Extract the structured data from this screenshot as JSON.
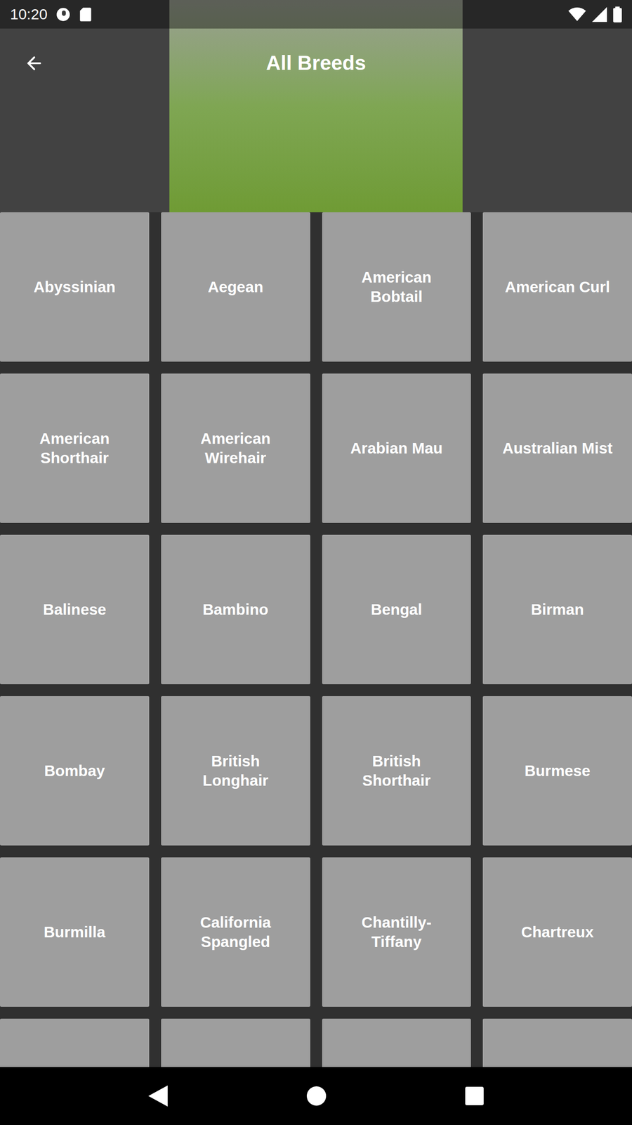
{
  "status_bar": {
    "time": "10:20"
  },
  "app_bar": {
    "title": "All Breeds"
  },
  "breeds": [
    "Abyssinian",
    "Aegean",
    "American Bobtail",
    "American Curl",
    "American Shorthair",
    "American Wirehair",
    "Arabian Mau",
    "Australian Mist",
    "Balinese",
    "Bambino",
    "Bengal",
    "Birman",
    "Bombay",
    "British Longhair",
    "British Shorthair",
    "Burmese",
    "Burmilla",
    "California Spangled",
    "Chantilly-Tiffany",
    "Chartreux"
  ]
}
